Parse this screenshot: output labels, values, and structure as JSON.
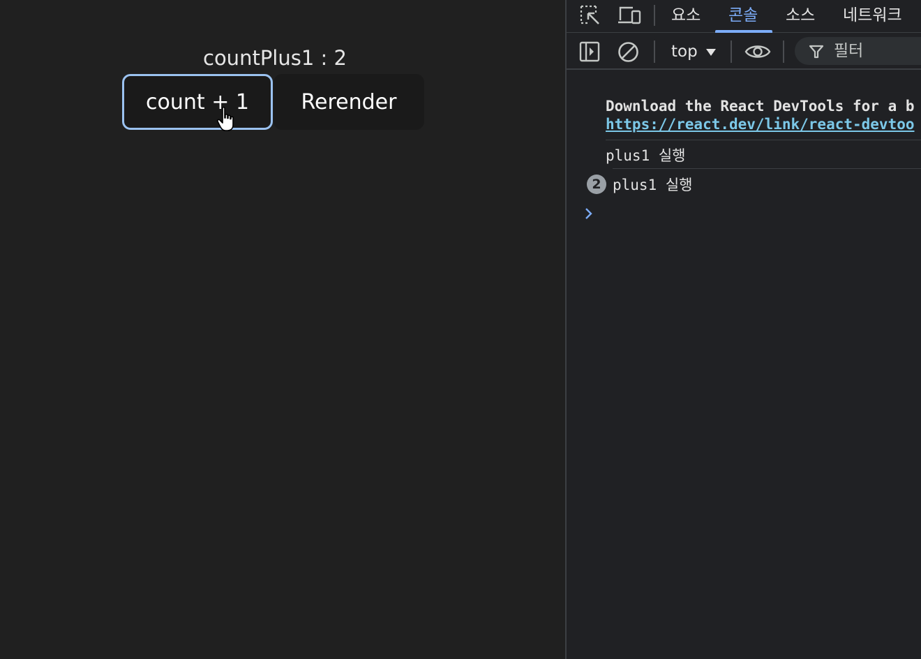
{
  "app": {
    "count_label": "countPlus1 : 2",
    "plus_button": "count + 1",
    "rerender_button": "Rerender"
  },
  "devtools": {
    "tabs": [
      {
        "label": "요소",
        "active": false
      },
      {
        "label": "콘솔",
        "active": true
      },
      {
        "label": "소스",
        "active": false
      },
      {
        "label": "네트워크",
        "active": false
      }
    ],
    "toolbar": {
      "context": "top",
      "filter_placeholder": "필터"
    },
    "console": {
      "message1_text": "Download the React DevTools for a b",
      "message1_link": "https://react.dev/link/react-devtoo",
      "message2": "plus1 실행",
      "message3": "plus1 실행",
      "message3_count": "2"
    }
  },
  "colors": {
    "accent": "#7cacf8",
    "focus_ring": "#9bc2f0",
    "link": "#7cc8e8"
  }
}
